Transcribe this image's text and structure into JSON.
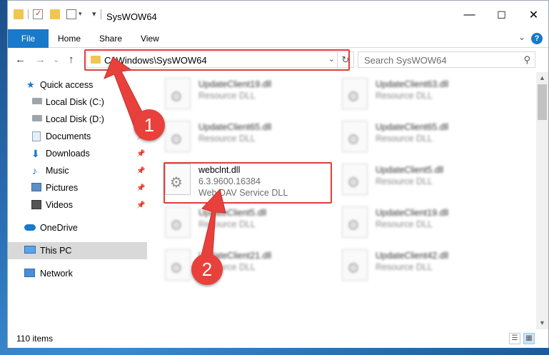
{
  "window": {
    "title": "SysWOW64",
    "controls": {
      "minimize": "—",
      "maximize": "☐",
      "close": "✕"
    }
  },
  "ribbon": {
    "tabs": [
      "File",
      "Home",
      "Share",
      "View"
    ],
    "help": "?",
    "collapse": "⌄"
  },
  "navigation": {
    "back": "←",
    "forward": "→",
    "recent": "⌄",
    "up": "↑",
    "address": "C:\\Windows\\SysWOW64",
    "address_dropdown": "⌄",
    "refresh": "↻",
    "search_placeholder": "Search SysWOW64",
    "search_icon": "⚲"
  },
  "sidebar": {
    "items": [
      {
        "label": "Quick access",
        "icon": "star-icon",
        "pinned": false
      },
      {
        "label": "Local Disk (C:)",
        "icon": "drive-icon",
        "pinned": false
      },
      {
        "label": "Local Disk (D:)",
        "icon": "drive-icon",
        "pinned": false
      },
      {
        "label": "Documents",
        "icon": "document-icon",
        "pinned": true
      },
      {
        "label": "Downloads",
        "icon": "download-icon",
        "pinned": true
      },
      {
        "label": "Music",
        "icon": "music-icon",
        "pinned": true
      },
      {
        "label": "Pictures",
        "icon": "picture-icon",
        "pinned": true
      },
      {
        "label": "Videos",
        "icon": "video-icon",
        "pinned": true
      },
      {
        "label": "OneDrive",
        "icon": "cloud-icon",
        "pinned": false
      },
      {
        "label": "This PC",
        "icon": "computer-icon",
        "pinned": false,
        "selected": true
      },
      {
        "label": "Network",
        "icon": "network-icon",
        "pinned": false
      }
    ],
    "pin_glyph": "📌"
  },
  "files": {
    "left_column": [
      {
        "name": "UpdateClient19.dll",
        "type": "Resource DLL",
        "blurred": true
      },
      {
        "name": "UpdateClient65.dll",
        "type": "Resource DLL",
        "blurred": true
      },
      {
        "name": "webclnt.dll",
        "version": "6.3.9600.16384",
        "type": "Web DAV Service DLL",
        "blurred": false
      },
      {
        "name": "UpdateClient5.dll",
        "type": "Resource DLL",
        "blurred": true
      },
      {
        "name": "UpdateClient21.dll",
        "type": "Resource DLL",
        "blurred": true
      }
    ],
    "right_column": [
      {
        "name": "UpdateClient63.dll",
        "type": "Resource DLL",
        "blurred": true
      },
      {
        "name": "UpdateClient65.dll",
        "type": "Resource DLL",
        "blurred": true
      },
      {
        "name": "UpdateClient5.dll",
        "type": "Resource DLL",
        "blurred": true
      },
      {
        "name": "UpdateClient19.dll",
        "type": "Resource DLL",
        "blurred": true
      },
      {
        "name": "UpdateClient42.dll",
        "type": "Resource DLL",
        "blurred": true
      }
    ]
  },
  "status": {
    "item_count": "110 items",
    "details_view": "☰",
    "tiles_view": "▦"
  },
  "annotations": {
    "step1": "1",
    "step2": "2",
    "highlight_color": "#e03d3d",
    "badge_color": "#e8413c"
  },
  "colors": {
    "accent": "#1979ca",
    "folder": "#f0c653",
    "selected": "#d9d9d9"
  }
}
